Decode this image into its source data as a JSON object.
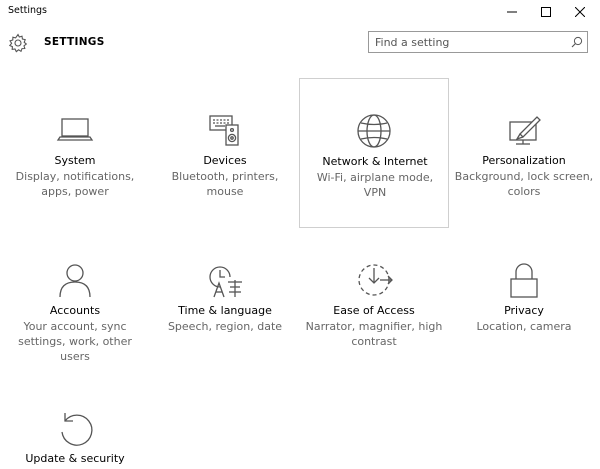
{
  "window": {
    "title": "Settings",
    "minimize_icon": "minimize-icon",
    "maximize_icon": "maximize-icon",
    "close_icon": "close-icon"
  },
  "header": {
    "icon": "gear-icon",
    "title": "SETTINGS"
  },
  "search": {
    "placeholder": "Find a setting",
    "value": "",
    "icon": "search-icon"
  },
  "categories": [
    {
      "name": "System",
      "desc": "Display, notifications, apps, power",
      "icon": "laptop-icon"
    },
    {
      "name": "Devices",
      "desc": "Bluetooth, printers, mouse",
      "icon": "devices-icon"
    },
    {
      "name": "Network & Internet",
      "desc": "Wi-Fi, airplane mode, VPN",
      "icon": "globe-icon"
    },
    {
      "name": "Personalization",
      "desc": "Background, lock screen, colors",
      "icon": "personalization-icon"
    },
    {
      "name": "Accounts",
      "desc": "Your account, sync settings, work, other users",
      "icon": "person-icon"
    },
    {
      "name": "Time & language",
      "desc": "Speech, region, date",
      "icon": "time-language-icon"
    },
    {
      "name": "Ease of Access",
      "desc": "Narrator, magnifier, high contrast",
      "icon": "ease-of-access-icon"
    },
    {
      "name": "Privacy",
      "desc": "Location, camera",
      "icon": "lock-icon"
    },
    {
      "name": "Update & security",
      "desc": "",
      "icon": "update-icon"
    }
  ],
  "colors": {
    "icon": "#555555",
    "description": "#666666",
    "selected_border": "#cfcfcf"
  }
}
